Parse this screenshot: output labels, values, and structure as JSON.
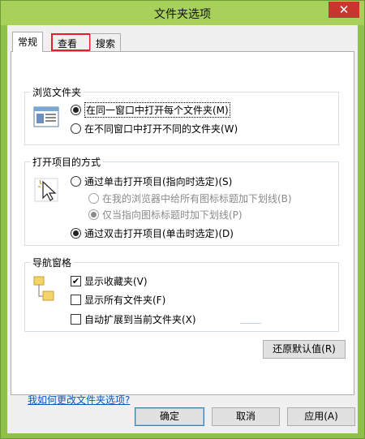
{
  "window": {
    "title": "文件夹选项",
    "close_glyph": "✕"
  },
  "tabs": [
    {
      "label": "常规"
    },
    {
      "label": "查看"
    },
    {
      "label": "搜索"
    }
  ],
  "browse": {
    "title": "浏览文件夹",
    "options": [
      {
        "label": "在同一窗口中打开每个文件夹(M)",
        "checked": true
      },
      {
        "label": "在不同窗口中打开不同的文件夹(W)",
        "checked": false
      }
    ]
  },
  "click": {
    "title": "打开项目的方式",
    "option_single": "通过单击打开项目(指向时选定)(S)",
    "sub_all": "在我的浏览器中给所有图标标题加下划线(B)",
    "sub_hover": "仅当指向图标标题时加下划线(P)",
    "option_double": "通过双击打开项目(单击时选定)(D)"
  },
  "nav": {
    "title": "导航窗格",
    "show_favorites": "显示收藏夹(V)",
    "show_all": "显示所有文件夹(F)",
    "auto_expand": "自动扩展到当前文件夹(X)",
    "check_glyph": "✔"
  },
  "restore_label": "还原默认值(R)",
  "help_link": "我如何更改文件夹选项?",
  "buttons": {
    "ok": "确定",
    "cancel": "取消",
    "apply": "应用(A)"
  }
}
